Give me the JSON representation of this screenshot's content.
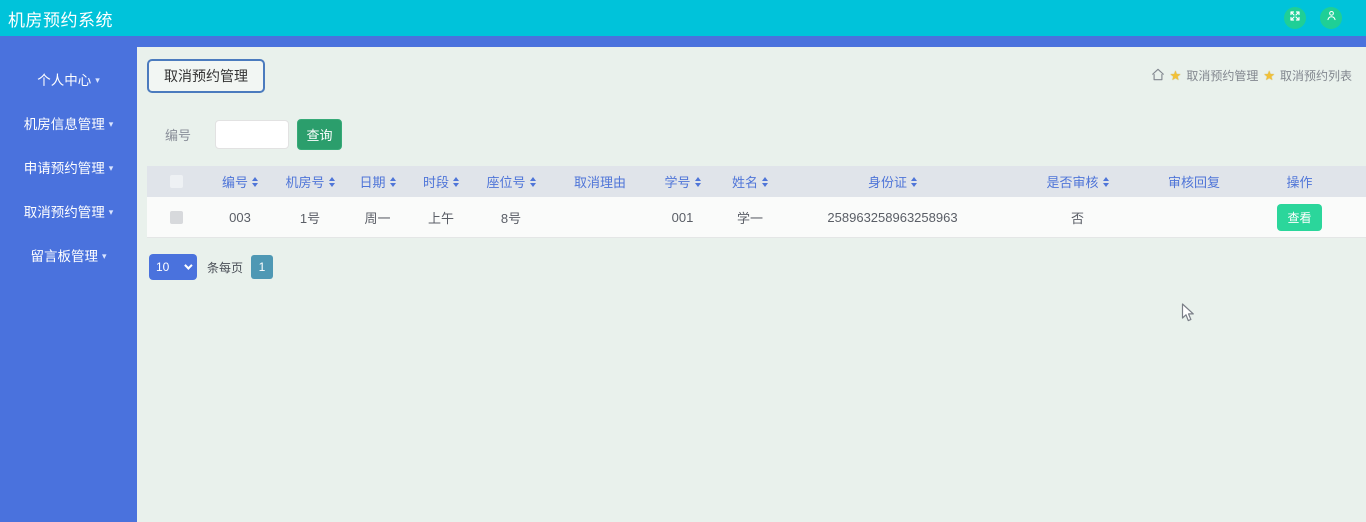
{
  "app": {
    "title": "机房预约系统"
  },
  "sidebar": {
    "items": [
      {
        "key": "personal-center",
        "label": "个人中心"
      },
      {
        "key": "room-info-management",
        "label": "机房信息管理"
      },
      {
        "key": "apply-reservation-management",
        "label": "申请预约管理"
      },
      {
        "key": "cancel-reservation-management",
        "label": "取消预约管理"
      },
      {
        "key": "message-board-management",
        "label": "留言板管理"
      }
    ]
  },
  "page": {
    "title": "取消预约管理",
    "breadcrumb": {
      "items": [
        "取消预约管理",
        "取消预约列表"
      ]
    },
    "search": {
      "label": "编号",
      "value": "",
      "button_label": "查询"
    },
    "table": {
      "columns": [
        {
          "key": "number",
          "label": "编号",
          "sortable": true
        },
        {
          "key": "room-number",
          "label": "机房号",
          "sortable": true
        },
        {
          "key": "date",
          "label": "日期",
          "sortable": true
        },
        {
          "key": "period",
          "label": "时段",
          "sortable": true
        },
        {
          "key": "seat-number",
          "label": "座位号",
          "sortable": true
        },
        {
          "key": "cancel-reason",
          "label": "取消理由",
          "sortable": false
        },
        {
          "key": "student-id",
          "label": "学号",
          "sortable": true
        },
        {
          "key": "name",
          "label": "姓名",
          "sortable": true
        },
        {
          "key": "id-card",
          "label": "身份证",
          "sortable": true
        },
        {
          "key": "reviewed",
          "label": "是否审核",
          "sortable": true
        },
        {
          "key": "review-reply",
          "label": "审核回复",
          "sortable": false
        },
        {
          "key": "actions",
          "label": "操作",
          "sortable": false
        }
      ],
      "rows": [
        {
          "checked": false,
          "cells": [
            "003",
            "1号",
            "周一",
            "上午",
            "8号",
            "",
            "001",
            "学一",
            "258963258963258963",
            "否",
            ""
          ],
          "action_label": "查看"
        }
      ]
    },
    "pagination": {
      "page_size": "10",
      "unit_label": "条每页",
      "pages": [
        "1"
      ],
      "current_page": "1"
    }
  },
  "colors": {
    "topbar_teal": "#00c3da",
    "sidebar_blue": "#4a72dd",
    "panel_bg": "#e9f1ec",
    "table_header_bg": "#e0e4ea",
    "table_header_text": "#4f75d8",
    "search_button_green": "#2b9e6c",
    "view_button_green": "#2bd69b",
    "page_button_teal": "#4f98b4",
    "circle_button_green": "#1fcf96",
    "star_gold": "#f3c136"
  }
}
